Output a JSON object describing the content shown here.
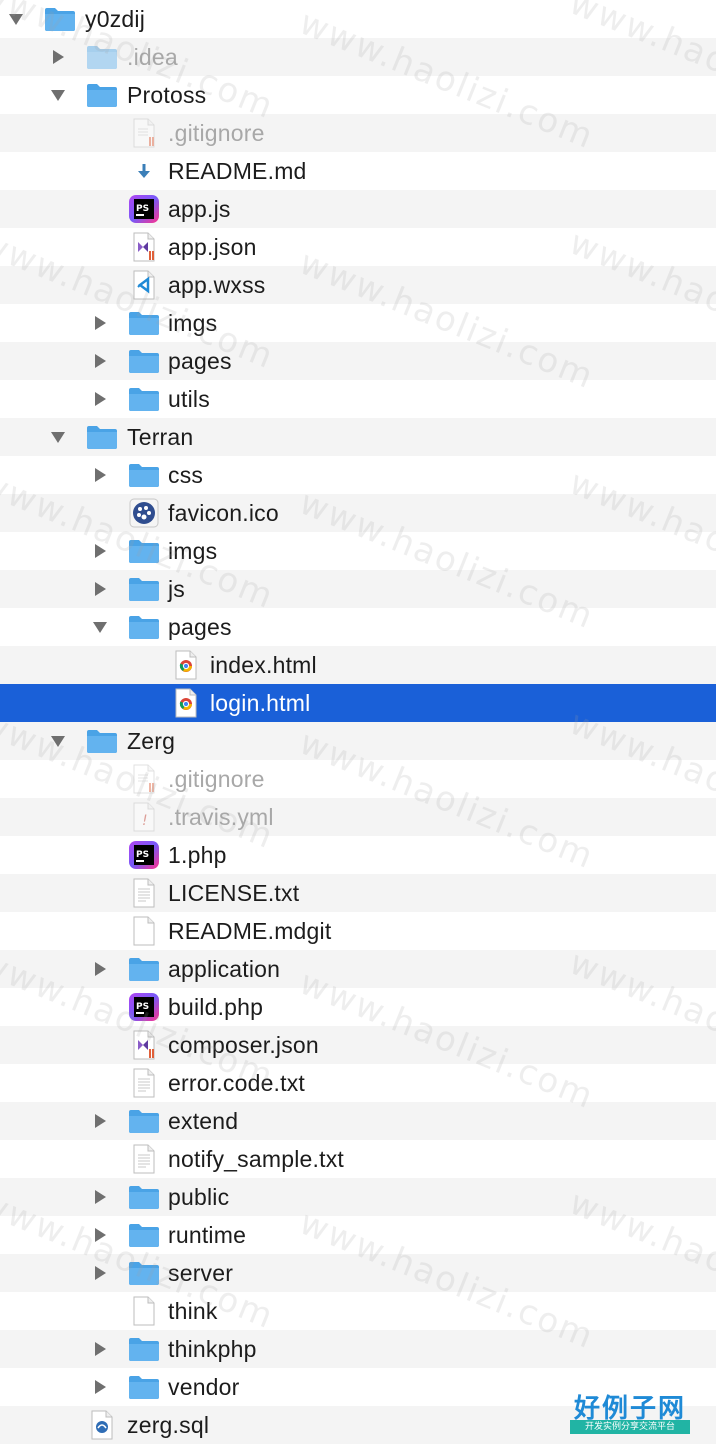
{
  "colors": {
    "selection": "#1a60d8",
    "stripe": "#f4f4f4",
    "folder": "#63b3ef",
    "dim_text": "#a8a8a8"
  },
  "tree": [
    {
      "label": "y0zdij",
      "level": 0,
      "type": "folder",
      "disclosure": "open",
      "icon": "folder-icon"
    },
    {
      "label": ".idea",
      "level": 1,
      "type": "folder",
      "disclosure": "closed",
      "icon": "folder-icon",
      "dim": true
    },
    {
      "label": "Protoss",
      "level": 1,
      "type": "folder",
      "disclosure": "open",
      "icon": "folder-icon"
    },
    {
      "label": ".gitignore",
      "level": 2,
      "type": "file",
      "icon": "gitignore-file-icon",
      "dim": true
    },
    {
      "label": "README.md",
      "level": 2,
      "type": "file",
      "icon": "markdown-file-icon"
    },
    {
      "label": "app.js",
      "level": 2,
      "type": "file",
      "icon": "phpstorm-file-icon"
    },
    {
      "label": "app.json",
      "level": 2,
      "type": "file",
      "icon": "visual-studio-file-icon"
    },
    {
      "label": "app.wxss",
      "level": 2,
      "type": "file",
      "icon": "vscode-file-icon"
    },
    {
      "label": "imgs",
      "level": 2,
      "type": "folder",
      "disclosure": "closed",
      "icon": "folder-icon"
    },
    {
      "label": "pages",
      "level": 2,
      "type": "folder",
      "disclosure": "closed",
      "icon": "folder-icon"
    },
    {
      "label": "utils",
      "level": 2,
      "type": "folder",
      "disclosure": "closed",
      "icon": "folder-icon"
    },
    {
      "label": "Terran",
      "level": 1,
      "type": "folder",
      "disclosure": "open",
      "icon": "folder-icon"
    },
    {
      "label": "css",
      "level": 2,
      "type": "folder",
      "disclosure": "closed",
      "icon": "folder-icon"
    },
    {
      "label": "favicon.ico",
      "level": 2,
      "type": "file",
      "icon": "favicon-file-icon"
    },
    {
      "label": "imgs",
      "level": 2,
      "type": "folder",
      "disclosure": "closed",
      "icon": "folder-icon"
    },
    {
      "label": "js",
      "level": 2,
      "type": "folder",
      "disclosure": "closed",
      "icon": "folder-icon"
    },
    {
      "label": "pages",
      "level": 2,
      "type": "folder",
      "disclosure": "open",
      "icon": "folder-icon"
    },
    {
      "label": "index.html",
      "level": 3,
      "type": "file",
      "icon": "chrome-file-icon"
    },
    {
      "label": "login.html",
      "level": 3,
      "type": "file",
      "icon": "chrome-file-icon",
      "selected": true
    },
    {
      "label": "Zerg",
      "level": 1,
      "type": "folder",
      "disclosure": "open",
      "icon": "folder-icon"
    },
    {
      "label": ".gitignore",
      "level": 2,
      "type": "file",
      "icon": "gitignore-file-icon",
      "dim": true
    },
    {
      "label": ".travis.yml",
      "level": 2,
      "type": "file",
      "icon": "yaml-file-icon",
      "dim": true
    },
    {
      "label": "1.php",
      "level": 2,
      "type": "file",
      "icon": "phpstorm-file-icon"
    },
    {
      "label": "LICENSE.txt",
      "level": 2,
      "type": "file",
      "icon": "text-file-icon"
    },
    {
      "label": "README.mdgit",
      "level": 2,
      "type": "file",
      "icon": "blank-file-icon"
    },
    {
      "label": "application",
      "level": 2,
      "type": "folder",
      "disclosure": "closed",
      "icon": "folder-icon"
    },
    {
      "label": "build.php",
      "level": 2,
      "type": "file",
      "icon": "phpstorm-file-icon"
    },
    {
      "label": "composer.json",
      "level": 2,
      "type": "file",
      "icon": "visual-studio-file-icon"
    },
    {
      "label": "error.code.txt",
      "level": 2,
      "type": "file",
      "icon": "text-file-icon"
    },
    {
      "label": "extend",
      "level": 2,
      "type": "folder",
      "disclosure": "closed",
      "icon": "folder-icon"
    },
    {
      "label": "notify_sample.txt",
      "level": 2,
      "type": "file",
      "icon": "text-file-icon"
    },
    {
      "label": "public",
      "level": 2,
      "type": "folder",
      "disclosure": "closed",
      "icon": "folder-icon"
    },
    {
      "label": "runtime",
      "level": 2,
      "type": "folder",
      "disclosure": "closed",
      "icon": "folder-icon"
    },
    {
      "label": "server",
      "level": 2,
      "type": "folder",
      "disclosure": "closed",
      "icon": "folder-icon"
    },
    {
      "label": "think",
      "level": 2,
      "type": "file",
      "icon": "blank-file-icon"
    },
    {
      "label": "thinkphp",
      "level": 2,
      "type": "folder",
      "disclosure": "closed",
      "icon": "folder-icon"
    },
    {
      "label": "vendor",
      "level": 2,
      "type": "folder",
      "disclosure": "closed",
      "icon": "folder-icon"
    },
    {
      "label": "zerg.sql",
      "level": 1,
      "type": "file",
      "icon": "sql-file-icon"
    }
  ],
  "watermark": "www.haolizi.com",
  "brand": {
    "title": "好例子网",
    "subtitle": "开发实例分享交流平台"
  }
}
